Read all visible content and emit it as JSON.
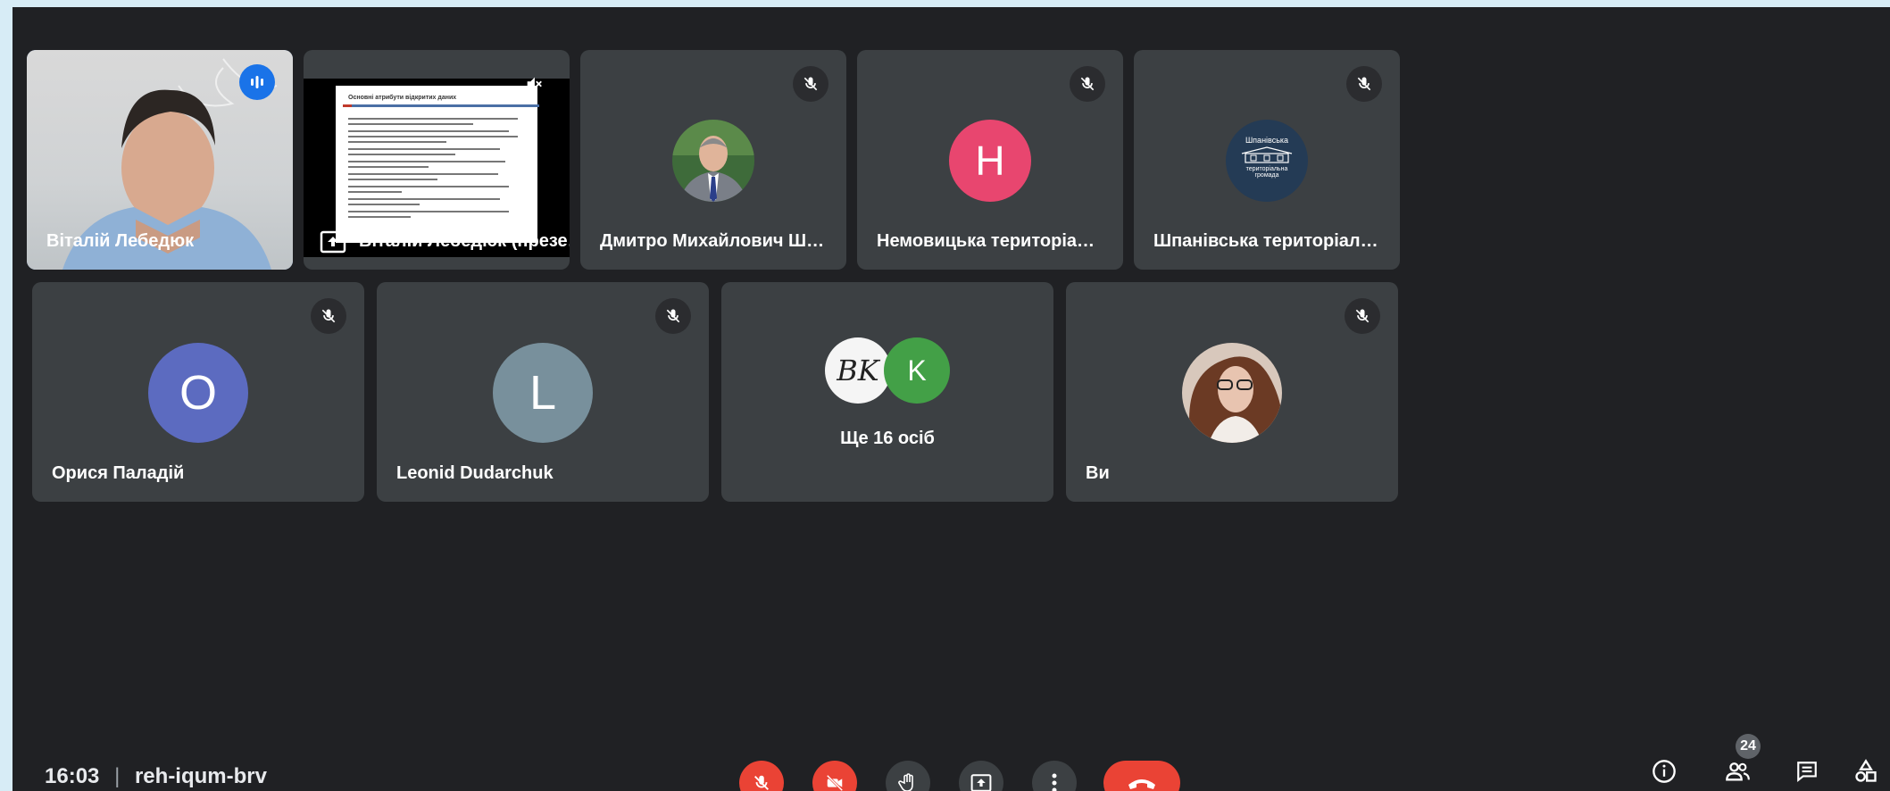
{
  "participants_row1": [
    {
      "name": "Віталій Лебедюк",
      "type": "video"
    },
    {
      "name": "Віталій Лебедюк (презент...",
      "type": "presentation"
    },
    {
      "name": "Дмитро Михайлович Шевчук",
      "type": "photo"
    },
    {
      "name": "Немовицька територіальна гр...",
      "type": "letter",
      "initial": "Н",
      "color": "#e8466f"
    },
    {
      "name": "Шпанівська територіальна гро...",
      "type": "logo",
      "logo_text": [
        "Шпанівська",
        "територіальна",
        "громада"
      ]
    }
  ],
  "participants_row2": [
    {
      "name": "Орися Паладій",
      "initial": "O",
      "color": "#5c6bc0"
    },
    {
      "name": "Leonid Dudarchuk",
      "initial": "L",
      "color": "#78909c"
    },
    {
      "others_label": "Ще 16 осіб",
      "initial": "K",
      "color": "#43a047",
      "logo_initials": "BK"
    },
    {
      "name": "Ви"
    }
  ],
  "slide": {
    "title": "Основні атрибути відкритих даних"
  },
  "footer": {
    "time": "16:03",
    "separator": "|",
    "meeting_code": "reh-iqum-brv",
    "participant_count": "24"
  },
  "controls": [
    "mic-off",
    "camera-off",
    "raise-hand",
    "present",
    "more",
    "hang-up"
  ],
  "right_controls": [
    "info",
    "people",
    "chat",
    "activities"
  ]
}
